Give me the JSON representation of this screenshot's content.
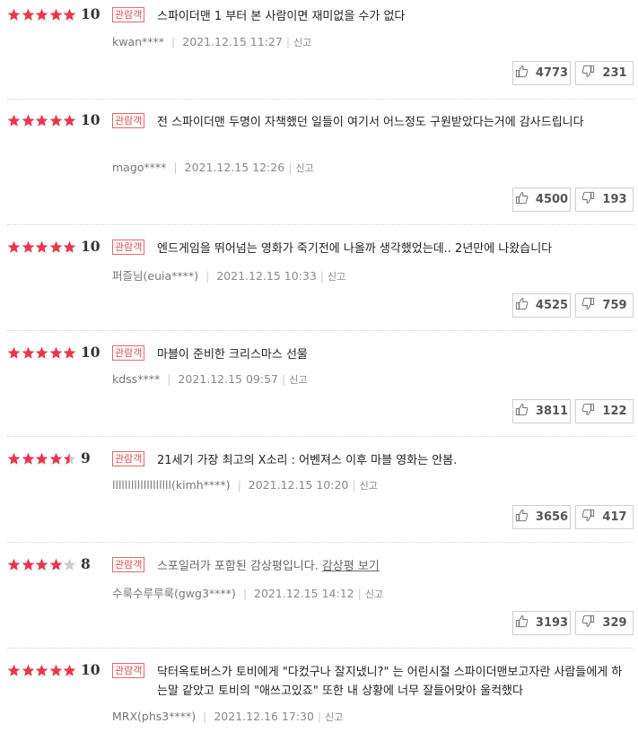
{
  "colors": {
    "star_on": "#e8364d",
    "star_off": "#cccccc",
    "badge": "#e05050"
  },
  "reviews": [
    {
      "rating": 10,
      "stars": 5,
      "score": "10",
      "badge": "관람객",
      "text": "스파이더맨 1 부터 본 사람이면 재미없을 수가 없다",
      "user": "kwan****",
      "date": "2021.12.15 11:27",
      "report": "신고",
      "likes": "4773",
      "dislikes": "231"
    },
    {
      "rating": 10,
      "stars": 5,
      "score": "10",
      "badge": "관람객",
      "text": "전 스파이더맨 두명이 자책했던 일들이 여기서 어느정도 구원받았다는거에 감사드립니다",
      "user": "mago****",
      "date": "2021.12.15 12:26",
      "report": "신고",
      "likes": "4500",
      "dislikes": "193"
    },
    {
      "rating": 10,
      "stars": 5,
      "score": "10",
      "badge": "관람객",
      "text": "엔드게임을 뛰어넘는 영화가 죽기전에 나올까 생각했었는데.. 2년만에 나왔습니다",
      "user": "퍼즐님(euia****)",
      "date": "2021.12.15 10:33",
      "report": "신고",
      "likes": "4525",
      "dislikes": "759"
    },
    {
      "rating": 10,
      "stars": 5,
      "score": "10",
      "badge": "관람객",
      "text": "마블이 준비한 크리스마스 선물",
      "user": "kdss****",
      "date": "2021.12.15 09:57",
      "report": "신고",
      "likes": "3811",
      "dislikes": "122"
    },
    {
      "rating": 9,
      "stars": 4.5,
      "score": "9",
      "badge": "관람객",
      "text": "21세기 가장 최고의 X소리 : 어벤져스 이후 마블 영화는 안봄.",
      "user": "lllllllllllllllllll(kimh****)",
      "date": "2021.12.15 10:20",
      "report": "신고",
      "likes": "3656",
      "dislikes": "417"
    },
    {
      "rating": 8,
      "stars": 4,
      "score": "8",
      "badge": "관람객",
      "text": "스포일러가 포함된 감상평입니다.",
      "spoiler_link": "감상평 보기",
      "user": "수룩수루루룩(gwg3****)",
      "date": "2021.12.15 14:12",
      "report": "신고",
      "likes": "3193",
      "dislikes": "329"
    },
    {
      "rating": 10,
      "stars": 5,
      "score": "10",
      "badge": "관람객",
      "text": "닥터옥토버스가 토비에게 \"다컸구나 잘지냈니?\" 는 어린시절 스파이더맨보고자란 사람들에게 하는말 같았고 토비의 \"애쓰고있죠\" 또한 내 상황에 너무 잘들어맞아 울컥했다",
      "user": "MRX(phs3****)",
      "date": "2021.12.16 17:30",
      "report": "신고",
      "likes": "",
      "dislikes": ""
    }
  ]
}
